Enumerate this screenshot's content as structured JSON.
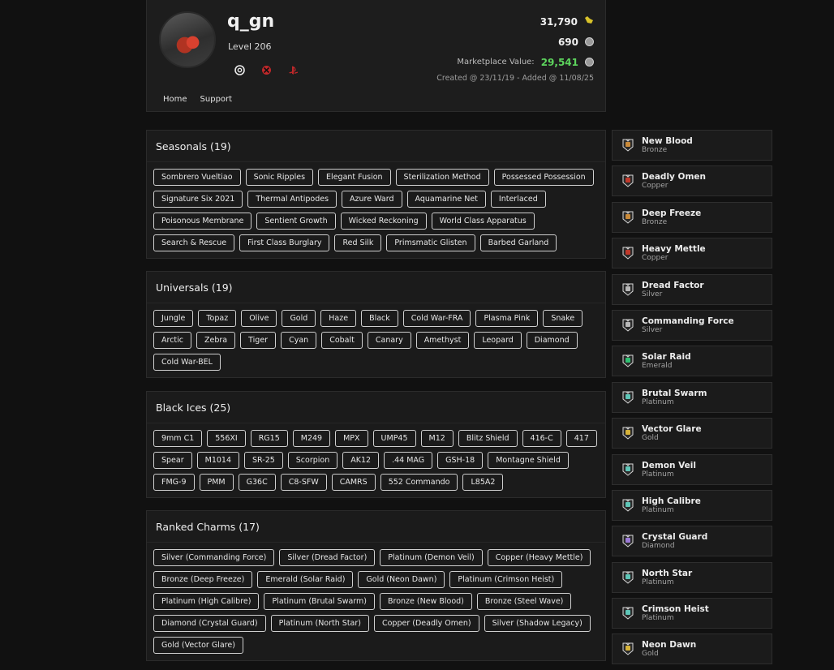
{
  "profile": {
    "username": "q_gn",
    "level": "Level 206",
    "credits": "31,790",
    "coins": "690",
    "marketplace_label": "Marketplace Value:",
    "marketplace_value": "29,541",
    "created": "Created @ 23/11/19 - Added @ 11/08/25",
    "platform_icons": [
      "ubisoft-icon",
      "xbox-icon",
      "playstation-icon"
    ]
  },
  "nav": {
    "home": "Home",
    "support": "Support"
  },
  "sections": {
    "seasonals": {
      "title": "Seasonals (19)",
      "tags": [
        "Sombrero Vueltiao",
        "Sonic Ripples",
        "Elegant Fusion",
        "Sterilization Method",
        "Possessed Possession",
        "Signature Six 2021",
        "Thermal Antipodes",
        "Azure Ward",
        "Aquamarine Net",
        "Interlaced",
        "Poisonous Membrane",
        "Sentient Growth",
        "Wicked Reckoning",
        "World Class Apparatus",
        "Search & Rescue",
        "First Class Burglary",
        "Red Silk",
        "Primsmatic Glisten",
        "Barbed Garland"
      ]
    },
    "universals": {
      "title": "Universals (19)",
      "tags": [
        "Jungle",
        "Topaz",
        "Olive",
        "Gold",
        "Haze",
        "Black",
        "Cold War-FRA",
        "Plasma Pink",
        "Snake",
        "Arctic",
        "Zebra",
        "Tiger",
        "Cyan",
        "Cobalt",
        "Canary",
        "Amethyst",
        "Leopard",
        "Diamond",
        "Cold War-BEL"
      ]
    },
    "black_ices": {
      "title": "Black Ices (25)",
      "tags": [
        "9mm C1",
        "556XI",
        "RG15",
        "M249",
        "MPX",
        "UMP45",
        "M12",
        "Blitz Shield",
        "416-C",
        "417",
        "Spear",
        "M1014",
        "SR-25",
        "Scorpion",
        "AK12",
        ".44 MAG",
        "GSH-18",
        "Montagne Shield",
        "FMG-9",
        "PMM",
        "G36C",
        "C8-SFW",
        "CAMRS",
        "552 Commando",
        "L85A2"
      ]
    },
    "ranked_charms": {
      "title": "Ranked Charms (17)",
      "tags": [
        "Silver (Commanding Force)",
        "Silver (Dread Factor)",
        "Platinum (Demon Veil)",
        "Copper (Heavy Mettle)",
        "Bronze (Deep Freeze)",
        "Emerald (Solar Raid)",
        "Gold (Neon Dawn)",
        "Platinum (Crimson Heist)",
        "Platinum (High Calibre)",
        "Platinum (Brutal Swarm)",
        "Bronze (New Blood)",
        "Bronze (Steel Wave)",
        "Diamond (Crystal Guard)",
        "Platinum (North Star)",
        "Copper (Deadly Omen)",
        "Silver (Shadow Legacy)",
        "Gold (Vector Glare)"
      ]
    }
  },
  "charm_list": [
    {
      "name": "New Blood",
      "rank": "Bronze",
      "color": "#c98a3a"
    },
    {
      "name": "Deadly Omen",
      "rank": "Copper",
      "color": "#c0392b"
    },
    {
      "name": "Deep Freeze",
      "rank": "Bronze",
      "color": "#c98a3a"
    },
    {
      "name": "Heavy Mettle",
      "rank": "Copper",
      "color": "#c0392b"
    },
    {
      "name": "Dread Factor",
      "rank": "Silver",
      "color": "#b8b8b8"
    },
    {
      "name": "Commanding Force",
      "rank": "Silver",
      "color": "#b8b8b8"
    },
    {
      "name": "Solar Raid",
      "rank": "Emerald",
      "color": "#2fbf71"
    },
    {
      "name": "Brutal Swarm",
      "rank": "Platinum",
      "color": "#5fc6b8"
    },
    {
      "name": "Vector Glare",
      "rank": "Gold",
      "color": "#d6b33a"
    },
    {
      "name": "Demon Veil",
      "rank": "Platinum",
      "color": "#5fc6b8"
    },
    {
      "name": "High Calibre",
      "rank": "Platinum",
      "color": "#5fc6b8"
    },
    {
      "name": "Crystal Guard",
      "rank": "Diamond",
      "color": "#9b7ad6"
    },
    {
      "name": "North Star",
      "rank": "Platinum",
      "color": "#5fc6b8"
    },
    {
      "name": "Crimson Heist",
      "rank": "Platinum",
      "color": "#5fc6b8"
    },
    {
      "name": "Neon Dawn",
      "rank": "Gold",
      "color": "#d6b33a"
    }
  ]
}
